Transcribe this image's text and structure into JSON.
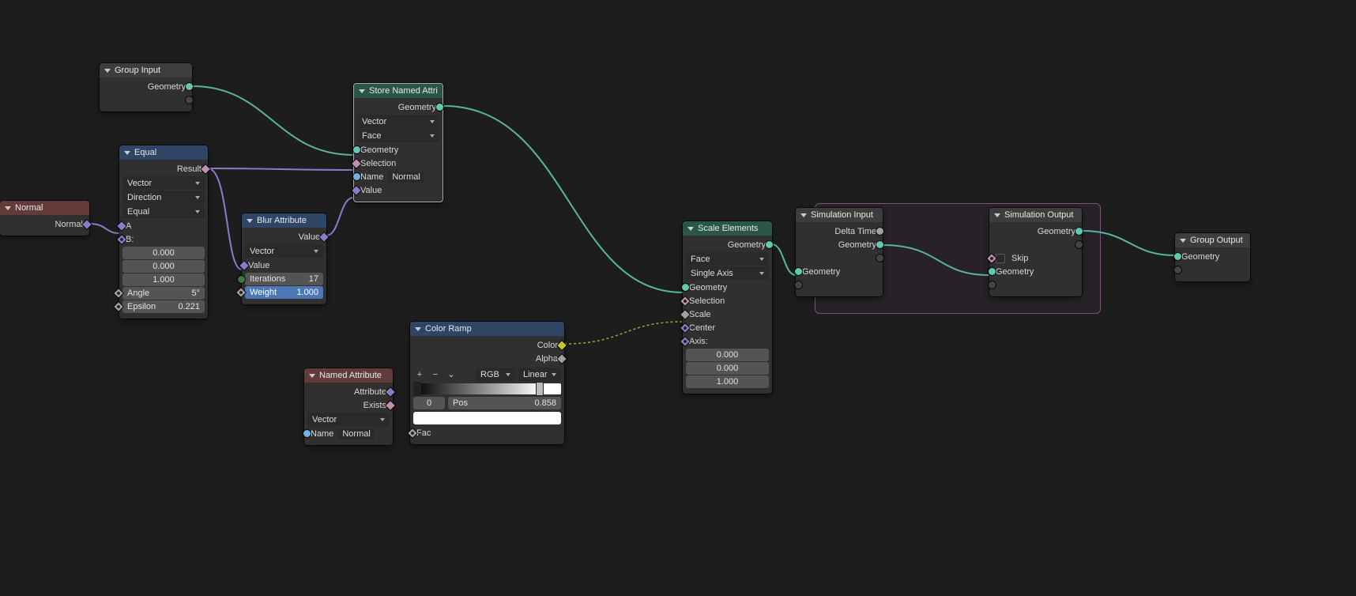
{
  "nodes": {
    "group_input": {
      "title": "Group Input",
      "out_geometry": "Geometry"
    },
    "normal": {
      "title": "Normal",
      "out_normal": "Normal"
    },
    "equal": {
      "title": "Equal",
      "out_result": "Result",
      "dd_type": "Vector",
      "dd_mode": "Direction",
      "dd_op": "Equal",
      "in_a": "A",
      "in_b": "B:",
      "bx": "0.000",
      "by": "0.000",
      "bz": "1.000",
      "angle_label": "Angle",
      "angle_val": "5°",
      "epsilon_label": "Epsilon",
      "epsilon_val": "0.221"
    },
    "blur": {
      "title": "Blur Attribute",
      "out_value": "Value",
      "dd_type": "Vector",
      "in_value": "Value",
      "iter_label": "Iterations",
      "iter_val": "17",
      "weight_label": "Weight",
      "weight_val": "1.000"
    },
    "store": {
      "title": "Store Named Attrib...",
      "out_geometry": "Geometry",
      "dd_type": "Vector",
      "dd_domain": "Face",
      "in_geometry": "Geometry",
      "in_selection": "Selection",
      "in_name_label": "Name",
      "in_name_value": "Normal",
      "in_value": "Value"
    },
    "named_attr": {
      "title": "Named Attribute",
      "out_attribute": "Attribute",
      "out_exists": "Exists",
      "dd_type": "Vector",
      "in_name_label": "Name",
      "in_name_value": "Normal"
    },
    "color_ramp": {
      "title": "Color Ramp",
      "out_color": "Color",
      "out_alpha": "Alpha",
      "dd_color_mode": "RGB",
      "dd_interp": "Linear",
      "stop_index": "0",
      "pos_label": "Pos",
      "pos_val": "0.858",
      "in_fac": "Fac"
    },
    "scale_elements": {
      "title": "Scale Elements",
      "out_geometry": "Geometry",
      "dd_domain": "Face",
      "dd_mode": "Single Axis",
      "in_geometry": "Geometry",
      "in_selection": "Selection",
      "in_scale": "Scale",
      "in_center": "Center",
      "in_axis": "Axis:",
      "ax": "0.000",
      "ay": "0.000",
      "az": "1.000"
    },
    "sim_input": {
      "title": "Simulation Input",
      "out_delta": "Delta Time",
      "out_geometry": "Geometry",
      "in_geometry": "Geometry"
    },
    "sim_output": {
      "title": "Simulation Output",
      "out_geometry": "Geometry",
      "in_skip": "Skip",
      "in_geometry": "Geometry"
    },
    "group_output": {
      "title": "Group Output",
      "in_geometry": "Geometry"
    }
  }
}
